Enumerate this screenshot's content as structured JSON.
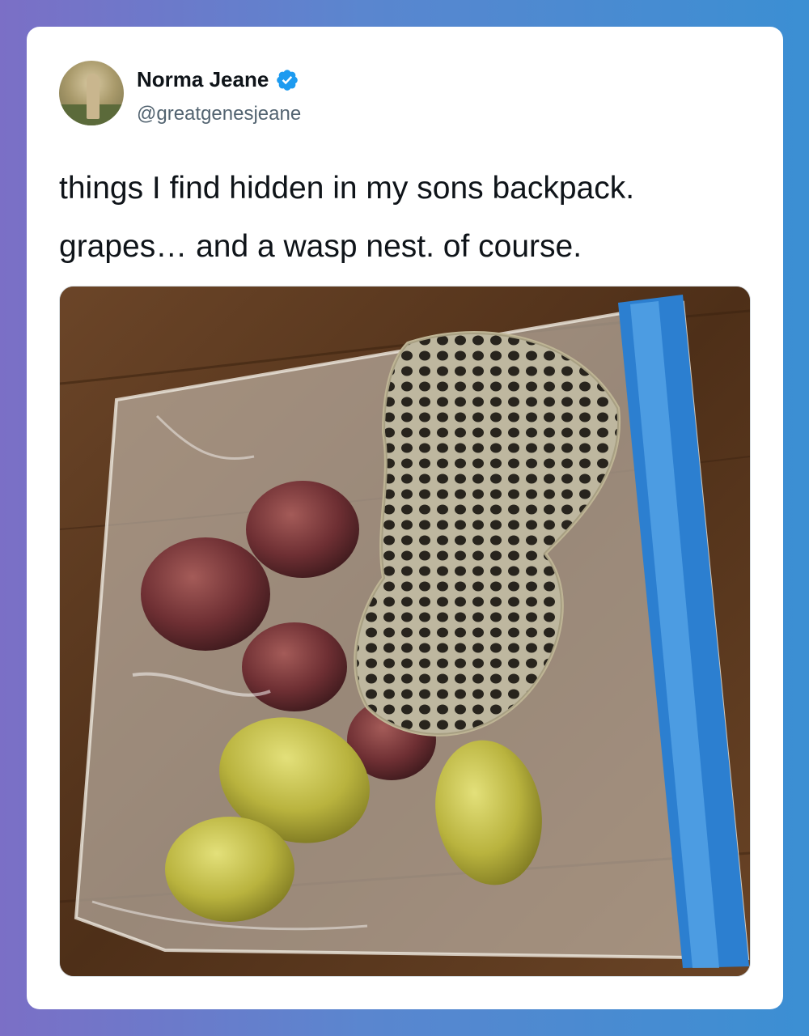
{
  "tweet": {
    "author": {
      "name": "Norma Jeane",
      "handle": "@greatgenesjeane",
      "verified": true,
      "avatar_icon": "profile-photo"
    },
    "text_lines": [
      "things I find hidden in my sons backpack.",
      "grapes… and a wasp nest. of course."
    ],
    "media": {
      "type": "photo",
      "subject": "ziplock bag with grapes and a wasp nest on a wooden table"
    }
  },
  "colors": {
    "verified_badge": "#1d9bf0",
    "background_left": "#7b6fc6",
    "background_right": "#3b8fd3"
  }
}
